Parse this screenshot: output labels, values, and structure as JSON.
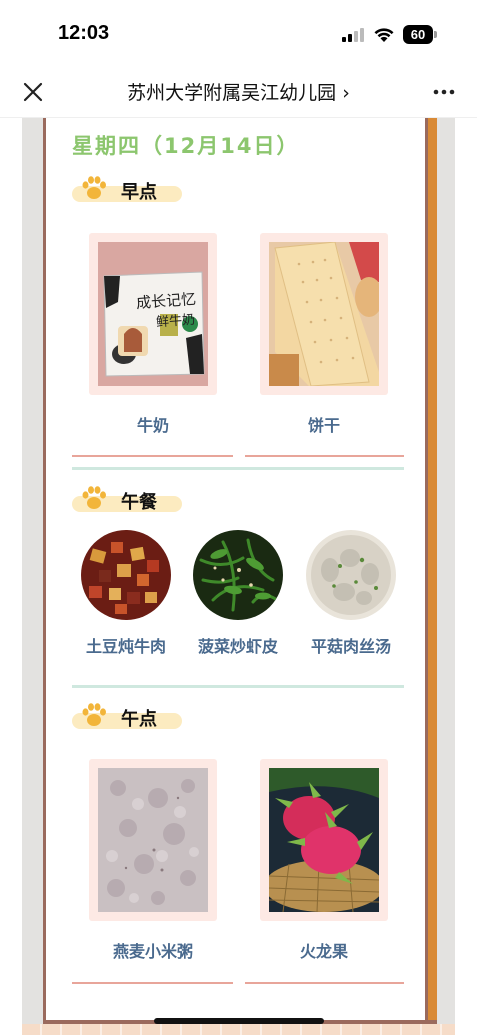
{
  "status_bar": {
    "time": "12:03",
    "battery": "60"
  },
  "nav": {
    "title": "苏州大学附属吴江幼儿园 ›"
  },
  "day": {
    "title": "星期四（12月14日）"
  },
  "sections": {
    "breakfast": {
      "label": "早点",
      "items": [
        "牛奶",
        "饼干"
      ]
    },
    "lunch": {
      "label": "午餐",
      "items": [
        "土豆炖牛肉",
        "菠菜炒虾皮",
        "平菇肉丝汤"
      ]
    },
    "snack": {
      "label": "午点",
      "items": [
        "燕麦小米粥",
        "火龙果"
      ]
    }
  },
  "milk_packet": {
    "line1": "成长记忆",
    "line2": "鲜牛奶"
  },
  "colors": {
    "accent_green": "#8cc66e",
    "label_blue": "#4a6a8e",
    "card_pink": "#fde9e4",
    "pill_yellow": "#fcebc0",
    "frame_brown": "#9a6a5d",
    "frame_orange": "#d98a36"
  },
  "icons": [
    "close-icon",
    "more-icon",
    "paw-icon",
    "signal-icon",
    "wifi-icon",
    "battery-icon"
  ]
}
